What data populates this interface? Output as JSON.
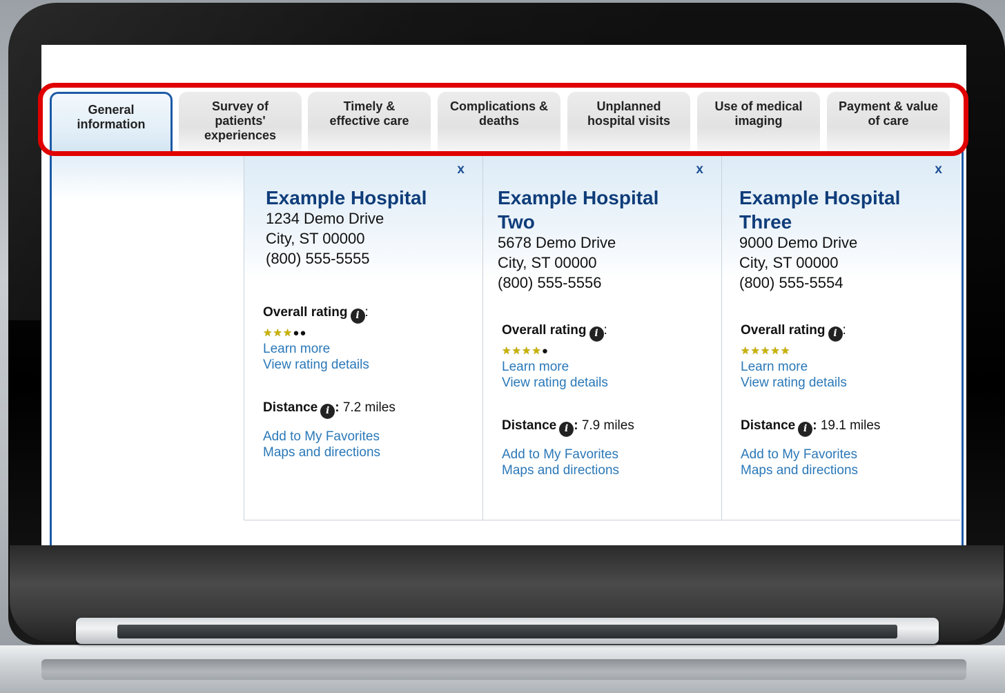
{
  "tabs": [
    {
      "label": "General\ninformation",
      "active": true
    },
    {
      "label": "Survey of\npatients'\nexperiences",
      "active": false
    },
    {
      "label": "Timely &\neffective care",
      "active": false
    },
    {
      "label": "Complications &\ndeaths",
      "active": false
    },
    {
      "label": "Unplanned\nhospital visits",
      "active": false
    },
    {
      "label": "Use of medical\nimaging",
      "active": false
    },
    {
      "label": "Payment & value\nof care",
      "active": false
    }
  ],
  "close_label": "x",
  "rating_label": "Overall rating",
  "distance_label": "Distance",
  "learn_more": "Learn more",
  "view_rating_details": "View rating details",
  "add_favorites": "Add to My Favorites",
  "maps_directions": "Maps and directions",
  "info_icon_glyph": "i",
  "hospitals": [
    {
      "name": "Example Hospital",
      "street": "1234 Demo Drive",
      "city": "City, ST 00000",
      "phone": "(800) 555-5555",
      "stars": 3,
      "star_max": 5,
      "distance": "7.2 miles"
    },
    {
      "name": "Example Hospital Two",
      "street": "5678 Demo Drive",
      "city": "City, ST 00000",
      "phone": "(800) 555-5556",
      "stars": 4,
      "star_max": 5,
      "distance": "7.9 miles"
    },
    {
      "name": "Example Hospital Three",
      "street": "9000 Demo Drive",
      "city": "City, ST 00000",
      "phone": "(800) 555-5554",
      "stars": 5,
      "star_max": 5,
      "distance": "19.1 miles"
    }
  ],
  "colors": {
    "accent": "#1c5aa6",
    "highlight": "#e00000",
    "link": "#2a78b8",
    "title": "#0f3d7a",
    "star": "#c9b200"
  }
}
